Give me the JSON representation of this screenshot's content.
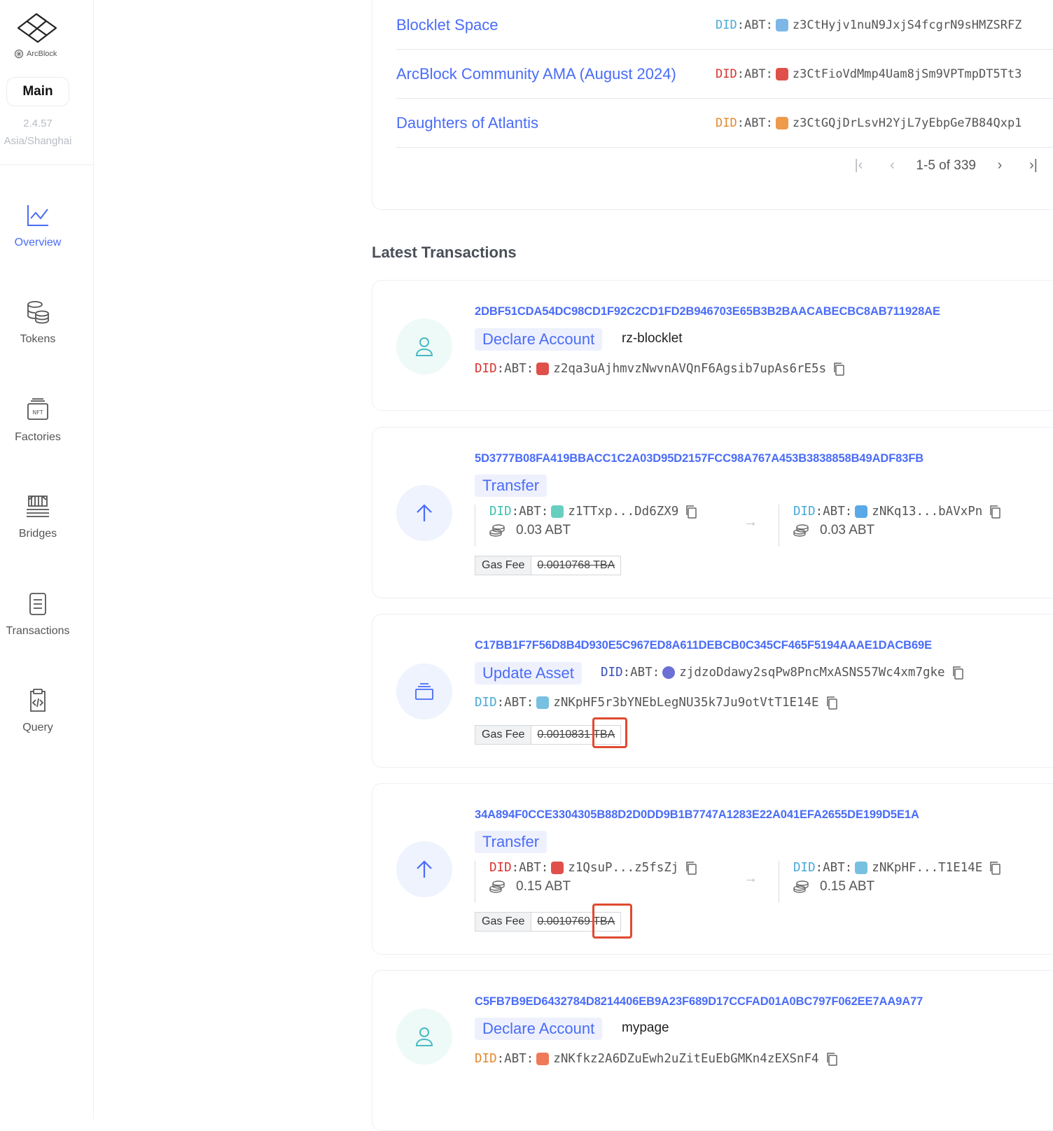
{
  "sidebar": {
    "brand": "ArcBlock",
    "chain": "Main",
    "version": "2.4.57",
    "timezone": "Asia/Shanghai",
    "nav": [
      {
        "label": "Overview",
        "icon": "chart-line-icon",
        "active": true
      },
      {
        "label": "Tokens",
        "icon": "database-coins-icon"
      },
      {
        "label": "Factories",
        "icon": "nft-icon"
      },
      {
        "label": "Bridges",
        "icon": "bridge-icon"
      },
      {
        "label": "Transactions",
        "icon": "document-list-icon"
      },
      {
        "label": "Query",
        "icon": "clipboard-code-icon"
      }
    ]
  },
  "dapps": {
    "rows": [
      {
        "name": "Blocklet Space",
        "did_prefix": "DID",
        "did_colon": ":ABT:",
        "did": "z3CtHyjv1nuN9JxjS4fcgrN9sHMZSRFZ",
        "prefix_color": "#4aa8d8",
        "avatar_color": "#7db7e8"
      },
      {
        "name": "ArcBlock Community AMA (August 2024)",
        "did_prefix": "DID",
        "did_colon": ":ABT:",
        "did": "z3CtFioVdMmp4Uam8jSm9VPTmpDT5Tt3",
        "prefix_color": "#d9332e",
        "avatar_color": "#e0504a"
      },
      {
        "name": "Daughters of Atlantis",
        "did_prefix": "DID",
        "did_colon": ":ABT:",
        "did": "z3CtGQjDrLsvH2YjL7yEbpGe7B84Qxp1",
        "prefix_color": "#e3892e",
        "avatar_color": "#ef9a4a"
      }
    ],
    "pagination": {
      "range": "1-5 of 339"
    }
  },
  "latest_transactions": {
    "title": "Latest Transactions",
    "items": [
      {
        "hash": "2DBF51CDA54DC98CD1F92C2CD1FD2B946703E65B3B2BAACABECBC8AB711928AE",
        "type": "Declare Account",
        "moniker": "rz-blocklet",
        "did_prefix": "DID",
        "did_colon": ":ABT:",
        "did": "z2qa3uAjhmvzNwvnAVQnF6Agsib7upAs6rE5s",
        "prefix_color": "#d9332e",
        "avatar_color": "#e0504a"
      },
      {
        "hash": "5D3777B08FA419BBACC1C2A03D95D2157FCC98A767A453B3838858B49ADF83FB",
        "type": "Transfer",
        "from": {
          "did_prefix": "DID",
          "did_colon": ":ABT:",
          "did": "z1TTxp...Dd6ZX9",
          "amount": "0.03 ABT",
          "prefix_color": "#3fbfb0",
          "avatar_color": "#68cfc0"
        },
        "to": {
          "did_prefix": "DID",
          "did_colon": ":ABT:",
          "did": "zNKq13...bAVxPn",
          "amount": "0.03 ABT",
          "prefix_color": "#4aa8d8",
          "avatar_color": "#5aa9e6"
        },
        "gas_label": "Gas Fee",
        "gas_value": "0.0010768 TBA"
      },
      {
        "hash": "C17BB1F7F56D8B4D930E5C967ED8A611DEBCB0C345CF465F5194AAAE1DACB69E",
        "type": "Update Asset",
        "asset": {
          "did_prefix": "DID",
          "did_colon": ":ABT:",
          "did": "zjdzoDdawy2sqPw8PncMxASNS57Wc4xm7gke",
          "prefix_color": "#3a4fb8",
          "avatar_color": "#6b6fd6"
        },
        "did_prefix": "DID",
        "did_colon": ":ABT:",
        "did": "zNKpHF5r3bYNEbLegNU35k7Ju9otVtT1E14E",
        "prefix_color": "#4aa8d8",
        "avatar_color": "#78c0e0",
        "gas_label": "Gas Fee",
        "gas_value": "0.0010831 TBA"
      },
      {
        "hash": "34A894F0CCE3304305B88D2D0DD9B1B7747A1283E22A041EFA2655DE199D5E1A",
        "type": "Transfer",
        "from": {
          "did_prefix": "DID",
          "did_colon": ":ABT:",
          "did": "z1QsuP...z5fsZj",
          "amount": "0.15 ABT",
          "prefix_color": "#d9332e",
          "avatar_color": "#e0504a"
        },
        "to": {
          "did_prefix": "DID",
          "did_colon": ":ABT:",
          "did": "zNKpHF...T1E14E",
          "amount": "0.15 ABT",
          "prefix_color": "#4aa8d8",
          "avatar_color": "#78c0e0"
        },
        "gas_label": "Gas Fee",
        "gas_value": "0.0010769 TBA"
      },
      {
        "hash": "C5FB7B9ED6432784D8214406EB9A23F689D17CCFAD01A0BC797F062EE7AA9A77",
        "type": "Declare Account",
        "moniker": "mypage",
        "did_prefix": "DID",
        "did_colon": ":ABT:",
        "did": "zNKfkz2A6DZuEwh2uZitEuEbGMKn4zEXSnF4",
        "prefix_color": "#e3892e",
        "avatar_color": "#ef7a5a"
      }
    ]
  },
  "colors": {
    "accent": "#4a6cf7",
    "highlight": "#e04a2f"
  }
}
